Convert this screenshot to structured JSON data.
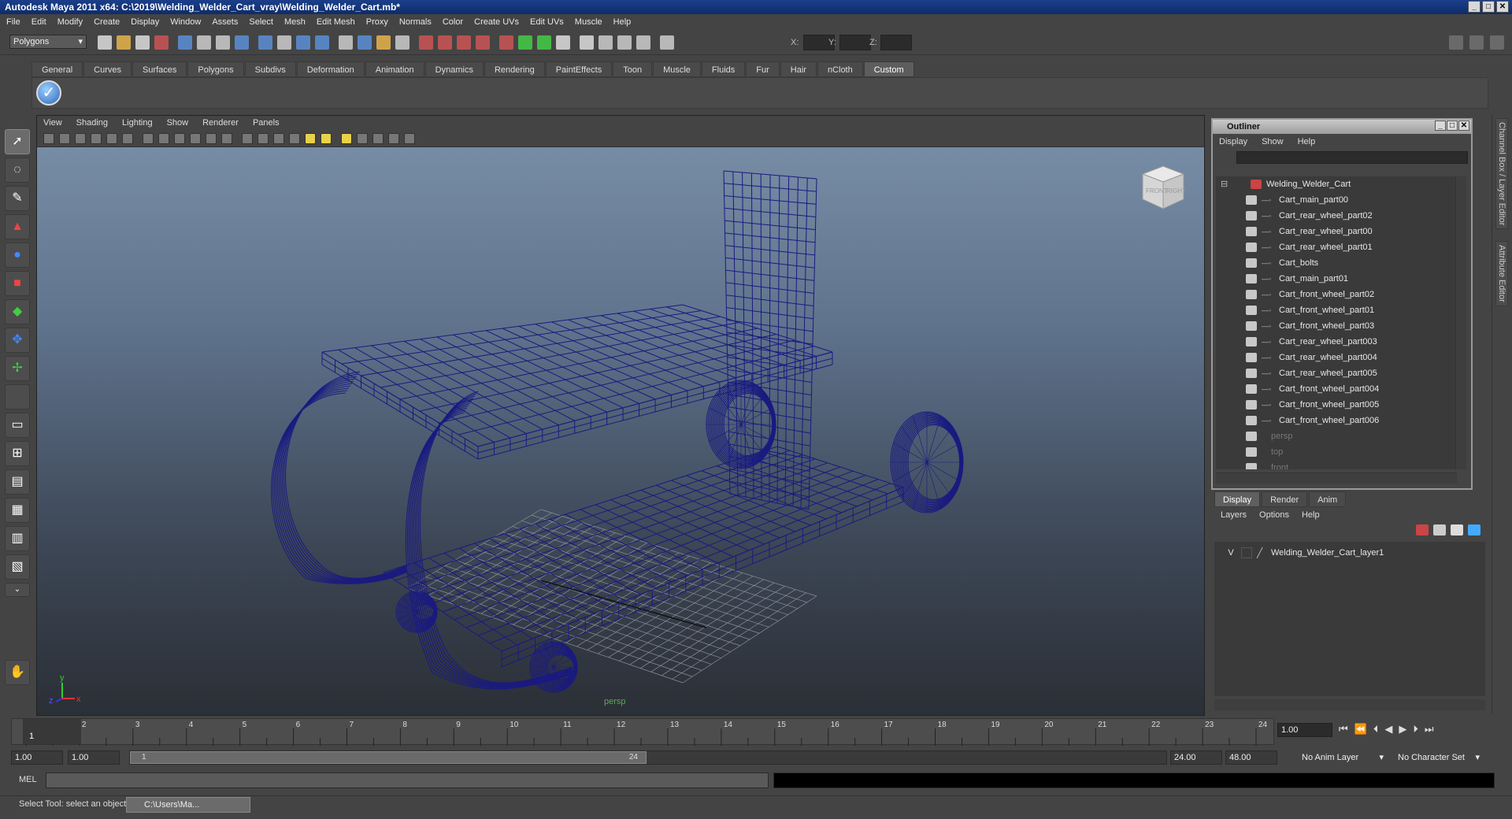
{
  "window": {
    "title": "Autodesk Maya 2011 x64: C:\\2019\\Welding_Welder_Cart_vray\\Welding_Welder_Cart.mb*"
  },
  "menubar": [
    "File",
    "Edit",
    "Modify",
    "Create",
    "Display",
    "Window",
    "Assets",
    "Select",
    "Mesh",
    "Edit Mesh",
    "Proxy",
    "Normals",
    "Color",
    "Create UVs",
    "Edit UVs",
    "Muscle",
    "Help"
  ],
  "status": {
    "mode": "Polygons",
    "x_label": "X:",
    "y_label": "Y:",
    "z_label": "Z:"
  },
  "shelf": {
    "tabs": [
      "General",
      "Curves",
      "Surfaces",
      "Polygons",
      "Subdivs",
      "Deformation",
      "Animation",
      "Dynamics",
      "Rendering",
      "PaintEffects",
      "Toon",
      "Muscle",
      "Fluids",
      "Fur",
      "Hair",
      "nCloth",
      "Custom"
    ],
    "active": "Custom"
  },
  "viewport": {
    "menu": [
      "View",
      "Shading",
      "Lighting",
      "Show",
      "Renderer",
      "Panels"
    ],
    "camera_label": "persp",
    "cube_front": "FRONT",
    "cube_right": "RIGHT",
    "axis_x": "x",
    "axis_y": "y",
    "axis_z": "z",
    "wire_color": "#1a1a80"
  },
  "outliner": {
    "title": "Outliner",
    "menu": [
      "Display",
      "Show",
      "Help"
    ],
    "root": "Welding_Welder_Cart",
    "children": [
      "Cart_main_part00",
      "Cart_rear_wheel_part02",
      "Cart_rear_wheel_part00",
      "Cart_rear_wheel_part01",
      "Cart_bolts",
      "Cart_main_part01",
      "Cart_front_wheel_part02",
      "Cart_front_wheel_part01",
      "Cart_front_wheel_part03",
      "Cart_rear_wheel_part003",
      "Cart_rear_wheel_part004",
      "Cart_rear_wheel_part005",
      "Cart_front_wheel_part004",
      "Cart_front_wheel_part005",
      "Cart_front_wheel_part006"
    ],
    "cameras": [
      "persp",
      "top",
      "front"
    ]
  },
  "layer_editor": {
    "tabs": [
      "Display",
      "Render",
      "Anim"
    ],
    "active": "Display",
    "menu": [
      "Layers",
      "Options",
      "Help"
    ],
    "layer_visibility": "V",
    "layer_name": "Welding_Welder_Cart_layer1"
  },
  "sidebar": {
    "tab1": "Channel Box / Layer Editor",
    "tab2": "Attribute Editor"
  },
  "timeline": {
    "ticks": [
      "1",
      "2",
      "3",
      "4",
      "5",
      "6",
      "7",
      "8",
      "9",
      "10",
      "11",
      "12",
      "13",
      "14",
      "15",
      "16",
      "17",
      "18",
      "19",
      "20",
      "21",
      "22",
      "23",
      "24"
    ],
    "current": "1",
    "current_frame_field": "1.00"
  },
  "range": {
    "start": "1.00",
    "playback_start": "1.00",
    "handle_left": "1",
    "handle_right": "24",
    "playback_end": "24.00",
    "end": "48.00",
    "anim_layer": "No Anim Layer",
    "char_set": "No Character Set"
  },
  "cmdline": {
    "label": "MEL"
  },
  "helpline": {
    "text": "Select Tool: select an object",
    "task": "C:\\Users\\Ma..."
  }
}
